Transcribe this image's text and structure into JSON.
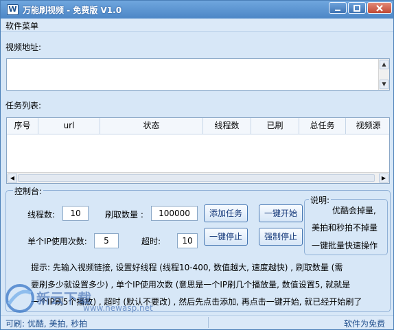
{
  "window": {
    "title": "万能刷视频 - 免费版 V1.0",
    "icon": "W"
  },
  "menu": {
    "item": "软件菜单"
  },
  "url_section": {
    "label": "视频地址:",
    "value": ""
  },
  "task_section": {
    "label": "任务列表:",
    "columns": [
      "序号",
      "url",
      "状态",
      "线程数",
      "已刷",
      "总任务",
      "视频源"
    ]
  },
  "control": {
    "title": "控制台:",
    "threads_label": "线程数:",
    "threads_value": "10",
    "count_label": "刷取数量 :",
    "count_value": "100000",
    "ip_label": "单个IP使用次数:",
    "ip_value": "5",
    "timeout_label": "超时:",
    "timeout_value": "10",
    "buttons": {
      "add_task": "添加任务",
      "start_all": "一键开始",
      "stop_all": "一键停止",
      "force_stop": "强制停止"
    },
    "explain": {
      "title": "说明:",
      "lines": [
        "优酷会掉量,",
        "美拍和秒拍不掉量",
        "一键批量快速操作"
      ]
    },
    "tips": [
      "提示: 先输入视频链接, 设置好线程 (线程10-400, 数值越大, 速度越快) , 刷取数量 (需",
      "要刷多少就设置多少) , 单个IP使用次数 (意思是一个IP刷几个播放量, 数值设置5, 就就是",
      "一个IP刷5个播放) , 超时 (默认不要改) , 然后先点击添加, 再点击一键开始, 就已经开始刷了"
    ]
  },
  "status": {
    "left": "可刷: 优酷, 美拍, 秒拍",
    "right": "软件为免费"
  },
  "watermark": {
    "text": "新云下载",
    "url": "www.newasp.net"
  },
  "colors": {
    "titlebar": "#4c86c6",
    "background": "#d7e7f7",
    "status_text": "#1f4e8c"
  }
}
